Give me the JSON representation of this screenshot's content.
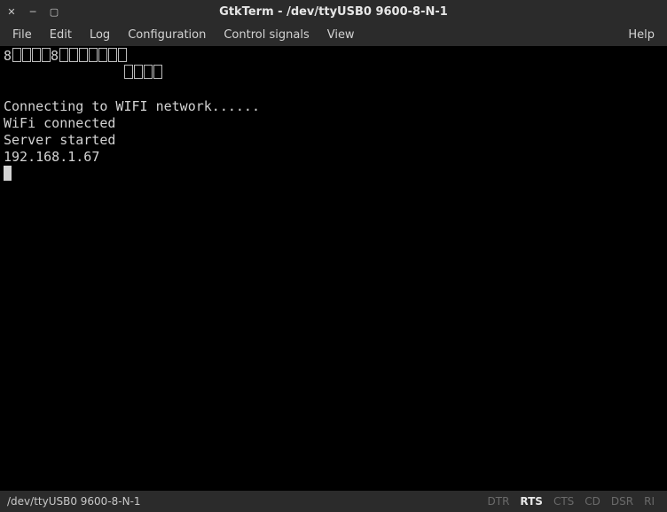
{
  "window": {
    "title": "GtkTerm - /dev/ttyUSB0  9600-8-N-1"
  },
  "menu": {
    "file": "File",
    "edit": "Edit",
    "log": "Log",
    "configuration": "Configuration",
    "control_signals": "Control signals",
    "view": "View",
    "help": "Help"
  },
  "terminal": {
    "line1_char": "8",
    "line3_text": "Connecting to WIFI network......",
    "line4_text": "WiFi connected",
    "line5_text": "Server started",
    "line6_text": "192.168.1.67"
  },
  "status": {
    "port": "/dev/ttyUSB0  9600-8-N-1",
    "signals": {
      "dtr": "DTR",
      "rts": "RTS",
      "cts": "CTS",
      "cd": "CD",
      "dsr": "DSR",
      "ri": "RI"
    }
  }
}
